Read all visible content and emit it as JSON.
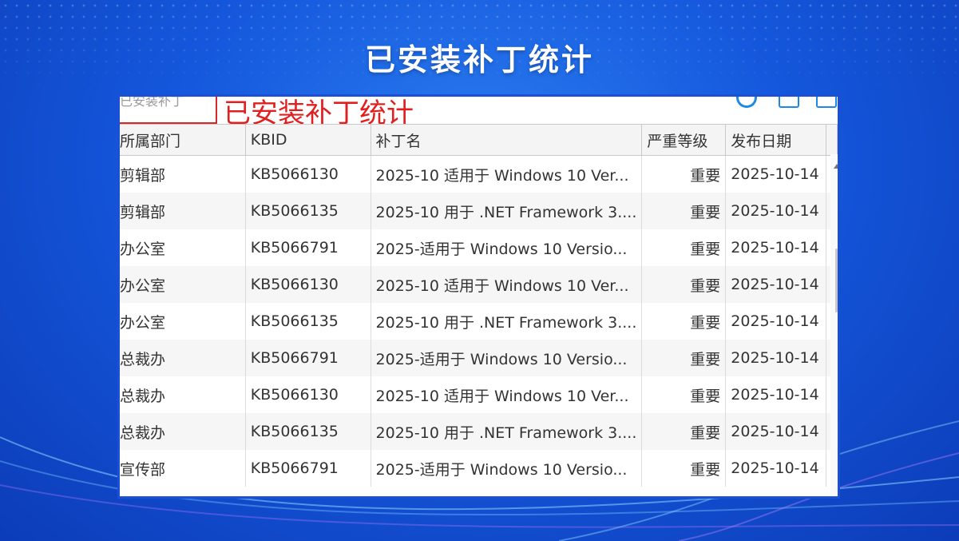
{
  "headline": "已安装补丁统计",
  "screenshot": {
    "search_value": "已安装补丁",
    "overlay_label": "已安装补丁统计",
    "columns": [
      "所属部门",
      "KBID",
      "补丁名",
      "严重等级",
      "发布日期"
    ],
    "rows": [
      {
        "dept": "剪辑部",
        "kbid": "KB5066130",
        "name": "2025-10 适用于 Windows 10 Ver...",
        "severity": "重要",
        "date": "2025-10-14"
      },
      {
        "dept": "剪辑部",
        "kbid": "KB5066135",
        "name": "2025-10 用于 .NET Framework 3....",
        "severity": "重要",
        "date": "2025-10-14"
      },
      {
        "dept": "办公室",
        "kbid": "KB5066791",
        "name": "2025-适用于 Windows 10 Versio...",
        "severity": "重要",
        "date": "2025-10-14"
      },
      {
        "dept": "办公室",
        "kbid": "KB5066130",
        "name": "2025-10 适用于 Windows 10 Ver...",
        "severity": "重要",
        "date": "2025-10-14"
      },
      {
        "dept": "办公室",
        "kbid": "KB5066135",
        "name": "2025-10 用于 .NET Framework 3....",
        "severity": "重要",
        "date": "2025-10-14"
      },
      {
        "dept": "总裁办",
        "kbid": "KB5066791",
        "name": "2025-适用于 Windows 10 Versio...",
        "severity": "重要",
        "date": "2025-10-14"
      },
      {
        "dept": "总裁办",
        "kbid": "KB5066130",
        "name": "2025-10 适用于 Windows 10 Ver...",
        "severity": "重要",
        "date": "2025-10-14"
      },
      {
        "dept": "总裁办",
        "kbid": "KB5066135",
        "name": "2025-10 用于 .NET Framework 3....",
        "severity": "重要",
        "date": "2025-10-14"
      },
      {
        "dept": "宣传部",
        "kbid": "KB5066791",
        "name": "2025-适用于 Windows 10 Versio...",
        "severity": "重要",
        "date": "2025-10-14"
      }
    ]
  },
  "icons": [
    "refresh-icon",
    "export-icon",
    "window-icon"
  ],
  "colors": {
    "background": "#1558dd",
    "frame": "#1a4fd6",
    "overlay_red": "#e02020",
    "headline": "#ffffff"
  }
}
